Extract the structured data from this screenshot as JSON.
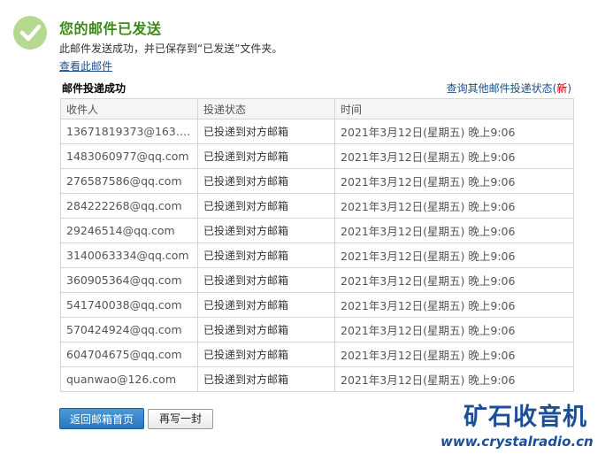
{
  "header": {
    "title": "您的邮件已发送",
    "subtitle": "此邮件发送成功，并已保存到“已发送”文件夹。",
    "view_link": "查看此邮件"
  },
  "delivery": {
    "section_title": "邮件投递成功",
    "query_link": "查询其他邮件投递状态",
    "query_new_open": "(",
    "query_new": "新",
    "query_new_close": ")",
    "columns": [
      "收件人",
      "投递状态",
      "时间"
    ],
    "rows": [
      {
        "recipient": "13671819373@163.c...",
        "status": "已投递到对方邮箱",
        "time": "2021年3月12日(星期五) 晚上9:06"
      },
      {
        "recipient": "1483060977@qq.com",
        "status": "已投递到对方邮箱",
        "time": "2021年3月12日(星期五) 晚上9:06"
      },
      {
        "recipient": "276587586@qq.com",
        "status": "已投递到对方邮箱",
        "time": "2021年3月12日(星期五) 晚上9:06"
      },
      {
        "recipient": "284222268@qq.com",
        "status": "已投递到对方邮箱",
        "time": "2021年3月12日(星期五) 晚上9:06"
      },
      {
        "recipient": "29246514@qq.com",
        "status": "已投递到对方邮箱",
        "time": "2021年3月12日(星期五) 晚上9:06"
      },
      {
        "recipient": "3140063334@qq.com",
        "status": "已投递到对方邮箱",
        "time": "2021年3月12日(星期五) 晚上9:06"
      },
      {
        "recipient": "360905364@qq.com",
        "status": "已投递到对方邮箱",
        "time": "2021年3月12日(星期五) 晚上9:06"
      },
      {
        "recipient": "541740038@qq.com",
        "status": "已投递到对方邮箱",
        "time": "2021年3月12日(星期五) 晚上9:06"
      },
      {
        "recipient": "570424924@qq.com",
        "status": "已投递到对方邮箱",
        "time": "2021年3月12日(星期五) 晚上9:06"
      },
      {
        "recipient": "604704675@qq.com",
        "status": "已投递到对方邮箱",
        "time": "2021年3月12日(星期五) 晚上9:06"
      },
      {
        "recipient": "quanwao@126.com",
        "status": "已投递到对方邮箱",
        "time": "2021年3月12日(星期五) 晚上9:06"
      }
    ]
  },
  "buttons": {
    "home": "返回邮箱首页",
    "write": "再写一封"
  },
  "watermark": {
    "title": "矿石收音机",
    "url": "www.crystalradio.cn"
  },
  "icons": {
    "success": "check-circle-icon"
  },
  "colors": {
    "title_green": "#3b8a16",
    "check_circle": "#b5d98e",
    "link_blue": "#1a4f8b",
    "new_red": "#c00000",
    "primary_button": "#2a76bd"
  }
}
